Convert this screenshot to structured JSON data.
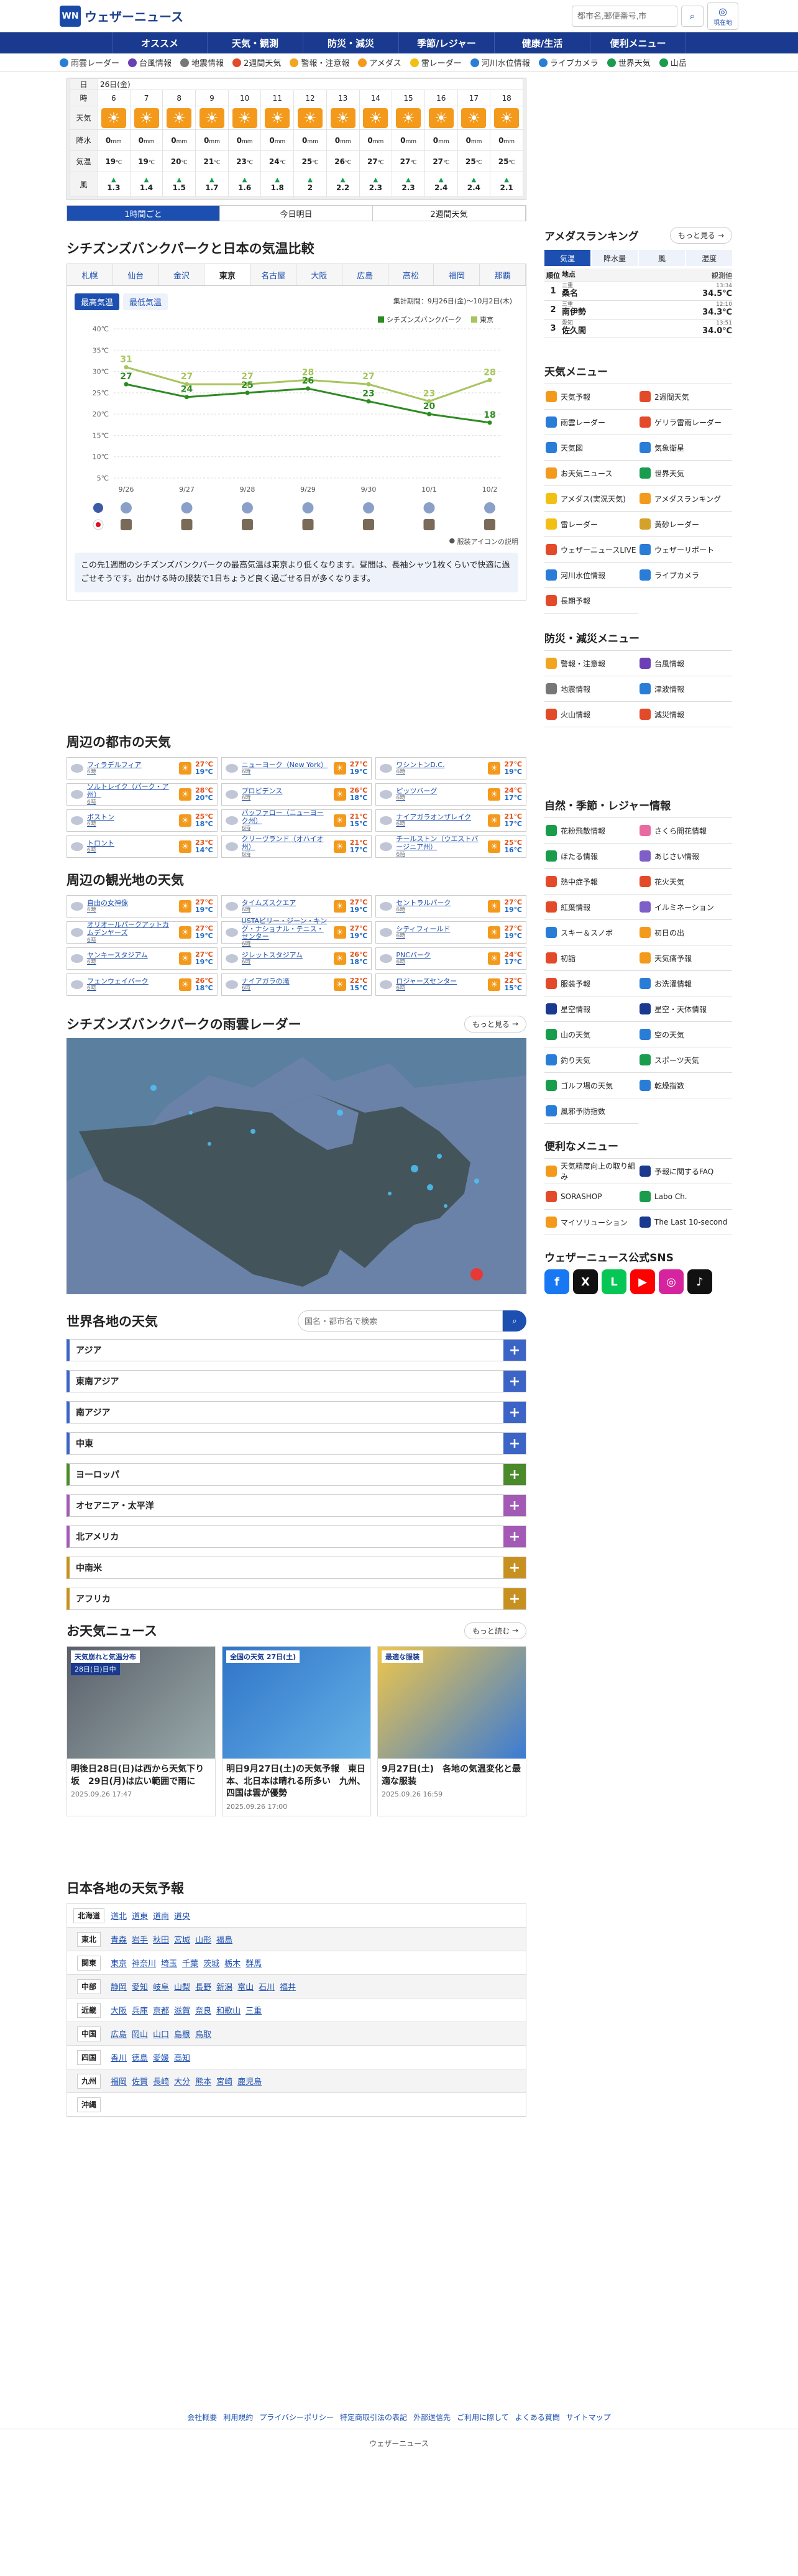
{
  "brand": {
    "logo_mark": "WN",
    "name": "ウェザーニュース"
  },
  "header": {
    "search_placeholder": "都市名,郵便番号,市",
    "current_label": "現在地"
  },
  "nav": [
    "オススメ",
    "天気・観測",
    "防災・減災",
    "季節/レジャー",
    "健康/生活",
    "便利メニュー"
  ],
  "subnav": [
    {
      "label": "雨雲レーダー",
      "color": "#2a7dd6"
    },
    {
      "label": "台風情報",
      "color": "#6c3fb7"
    },
    {
      "label": "地震情報",
      "color": "#777"
    },
    {
      "label": "2週間天気",
      "color": "#e34a2a"
    },
    {
      "label": "警報・注意報",
      "color": "#f2a520"
    },
    {
      "label": "アメダス",
      "color": "#f39a1c"
    },
    {
      "label": "雷レーダー",
      "color": "#f2c014"
    },
    {
      "label": "河川水位情報",
      "color": "#2a7dd6"
    },
    {
      "label": "ライブカメラ",
      "color": "#2a7dd6"
    },
    {
      "label": "世界天気",
      "color": "#1a9c4d"
    },
    {
      "label": "山岳",
      "color": "#1a9c4d"
    }
  ],
  "forecast": {
    "date_label": "26日(金)",
    "row_hour": "時",
    "row_day": "日",
    "row_weather": "天気",
    "row_rain": "降水",
    "row_temp": "気温",
    "row_wind": "風",
    "hours": [
      "6",
      "7",
      "8",
      "9",
      "10",
      "11",
      "12",
      "13",
      "14",
      "15",
      "16",
      "17",
      "18"
    ],
    "rain": [
      "0",
      "0",
      "0",
      "0",
      "0",
      "0",
      "0",
      "0",
      "0",
      "0",
      "0",
      "0",
      "0"
    ],
    "temps": [
      "19",
      "19",
      "20",
      "21",
      "23",
      "24",
      "25",
      "26",
      "27",
      "27",
      "27",
      "25",
      "25"
    ],
    "wind": [
      "1.3",
      "1.4",
      "1.5",
      "1.7",
      "1.6",
      "1.8",
      "2",
      "2.2",
      "2.3",
      "2.3",
      "2.4",
      "2.4",
      "2.1"
    ],
    "tabs": [
      "1時間ごと",
      "今日明日",
      "2週間天気"
    ]
  },
  "compare": {
    "title": "シチズンズバンクパークと日本の気温比較",
    "regions": [
      "札幌",
      "仙台",
      "金沢",
      "東京",
      "名古屋",
      "大阪",
      "広島",
      "高松",
      "福岡",
      "那覇"
    ],
    "type_buttons": [
      "最高気温",
      "最低気温"
    ],
    "period": "集計期間：9月26日(金)〜10月2日(木)",
    "icon_note": "服装アイコンの説明",
    "note": "この先1週間のシチズンズバンクパークの最高気温は東京より低くなります。昼間は、長袖シャツ1枚くらいで快適に過ごせそうです。出かける時の服装で1日ちょうど良く過ごせる日が多くなります。"
  },
  "chart_data": {
    "type": "line",
    "title": "",
    "x": [
      "9/26",
      "9/27",
      "9/28",
      "9/29",
      "9/30",
      "10/1",
      "10/2"
    ],
    "ylim": [
      5,
      40
    ],
    "yticks": [
      "5℃",
      "10℃",
      "15℃",
      "20℃",
      "25℃",
      "30℃",
      "35℃",
      "40℃"
    ],
    "grid": true,
    "legend": "top-right",
    "series": [
      {
        "name": "シチズンズバンクパーク",
        "color": "#2e8b23",
        "values": [
          27,
          24,
          25,
          26,
          23,
          20,
          18
        ]
      },
      {
        "name": "東京",
        "color": "#a6c55b",
        "values": [
          31,
          27,
          27,
          28,
          27,
          23,
          28
        ]
      }
    ]
  },
  "cities": {
    "title": "周辺の都市の天気",
    "day": "6時",
    "items": [
      {
        "name": "フィラデルフィア",
        "hi": "27℃",
        "lo": "19℃"
      },
      {
        "name": "ニューヨーク（New York）",
        "hi": "27℃",
        "lo": "19℃"
      },
      {
        "name": "ワシントンD.C.",
        "hi": "27℃",
        "lo": "19℃"
      },
      {
        "name": "ソルトレイク（パーク・ア州）",
        "hi": "28℃",
        "lo": "20℃"
      },
      {
        "name": "プロビデンス",
        "hi": "26℃",
        "lo": "18℃"
      },
      {
        "name": "ピッツバーグ",
        "hi": "24℃",
        "lo": "17℃"
      },
      {
        "name": "ボストン",
        "hi": "25℃",
        "lo": "18℃"
      },
      {
        "name": "バッファロー（ニューヨーク州）",
        "hi": "21℃",
        "lo": "15℃"
      },
      {
        "name": "ナイアガラオンザレイク",
        "hi": "21℃",
        "lo": "17℃"
      },
      {
        "name": "トロント",
        "hi": "23℃",
        "lo": "14℃"
      },
      {
        "name": "クリーヴランド（オハイオ州）",
        "hi": "21℃",
        "lo": "17℃"
      },
      {
        "name": "チールストン（ウエストバージニア州）",
        "hi": "25℃",
        "lo": "16℃"
      }
    ]
  },
  "sights": {
    "title": "周辺の観光地の天気",
    "items": [
      {
        "name": "自由の女神像",
        "hi": "27℃",
        "lo": "19℃"
      },
      {
        "name": "タイムズスクエア",
        "hi": "27℃",
        "lo": "19℃"
      },
      {
        "name": "セントラルパーク",
        "hi": "27℃",
        "lo": "19℃"
      },
      {
        "name": "オリオールパークアットカムデンヤーズ",
        "hi": "27℃",
        "lo": "19℃"
      },
      {
        "name": "USTAビリー・ジーン・キング・ナショナル・テニス・センター",
        "hi": "27℃",
        "lo": "19℃"
      },
      {
        "name": "シティフィールド",
        "hi": "27℃",
        "lo": "19℃"
      },
      {
        "name": "ヤンキースタジアム",
        "hi": "27℃",
        "lo": "19℃"
      },
      {
        "name": "ジレットスタジアム",
        "hi": "26℃",
        "lo": "18℃"
      },
      {
        "name": "PNCパーク",
        "hi": "24℃",
        "lo": "17℃"
      },
      {
        "name": "フェンウェイパーク",
        "hi": "26℃",
        "lo": "18℃"
      },
      {
        "name": "ナイアガラの滝",
        "hi": "22℃",
        "lo": "15℃"
      },
      {
        "name": "ロジャーズセンター",
        "hi": "22℃",
        "lo": "15℃"
      }
    ]
  },
  "radar": {
    "title": "シチズンズバンクパークの雨雲レーダー",
    "more": "もっと見る"
  },
  "world": {
    "title": "世界各地の天気",
    "search_placeholder": "国名・都市名で検索",
    "regions": [
      {
        "label": "アジア",
        "color": "#3b64c6"
      },
      {
        "label": "東南アジア",
        "color": "#3b64c6"
      },
      {
        "label": "南アジア",
        "color": "#3b64c6"
      },
      {
        "label": "中東",
        "color": "#3b64c6"
      },
      {
        "label": "ヨーロッパ",
        "color": "#4b8a2a"
      },
      {
        "label": "オセアニア・太平洋",
        "color": "#a25ab5"
      },
      {
        "label": "北アメリカ",
        "color": "#a25ab5"
      },
      {
        "label": "中南米",
        "color": "#c79122"
      },
      {
        "label": "アフリカ",
        "color": "#c79122"
      }
    ]
  },
  "news": {
    "title": "お天気ニュース",
    "more": "もっと読む",
    "items": [
      {
        "title": "明後日28日(日)は西から天気下り坂　29日(月)は広い範囲で雨に",
        "date": "2025.09.26 17:47",
        "tag": "天気崩れと気温分布",
        "tag2": "28日(日)日中"
      },
      {
        "title": "明日9月27日(土)の天気予報　東日本、北日本は晴れる所多い　九州、四国は雲が優勢",
        "date": "2025.09.26 17:00",
        "tag": "全国の天気 27日(土)",
        "tag2": ""
      },
      {
        "title": "9月27日(土)　各地の気温変化と最適な服装",
        "date": "2025.09.26 16:59",
        "tag": "最適な服装",
        "tag2": ""
      }
    ]
  },
  "japan": {
    "title": "日本各地の天気予報",
    "rows": [
      {
        "region": "北海道",
        "prefs": [
          "道北",
          "道東",
          "道南",
          "道央"
        ]
      },
      {
        "region": "東北",
        "prefs": [
          "青森",
          "岩手",
          "秋田",
          "宮城",
          "山形",
          "福島"
        ]
      },
      {
        "region": "関東",
        "prefs": [
          "東京",
          "神奈川",
          "埼玉",
          "千葉",
          "茨城",
          "栃木",
          "群馬"
        ]
      },
      {
        "region": "中部",
        "prefs": [
          "静岡",
          "愛知",
          "岐阜",
          "山梨",
          "長野",
          "新潟",
          "富山",
          "石川",
          "福井"
        ]
      },
      {
        "region": "近畿",
        "prefs": [
          "大阪",
          "兵庫",
          "京都",
          "滋賀",
          "奈良",
          "和歌山",
          "三重"
        ]
      },
      {
        "region": "中国",
        "prefs": [
          "広島",
          "岡山",
          "山口",
          "島根",
          "鳥取"
        ]
      },
      {
        "region": "四国",
        "prefs": [
          "香川",
          "徳島",
          "愛媛",
          "高知"
        ]
      },
      {
        "region": "九州",
        "prefs": [
          "福岡",
          "佐賀",
          "長崎",
          "大分",
          "熊本",
          "宮崎",
          "鹿児島"
        ]
      },
      {
        "region": "沖縄",
        "prefs": []
      }
    ]
  },
  "amedas": {
    "title": "アメダスランキング",
    "more": "もっと見る",
    "tabs": [
      "気温",
      "降水量",
      "風",
      "湿度"
    ],
    "h_rank": "順位",
    "h_place": "地点",
    "h_time": "観測値",
    "rows": [
      {
        "rank": "1",
        "pref": "三重",
        "place": "桑名",
        "time": "13:34",
        "value": "34.5℃"
      },
      {
        "rank": "2",
        "pref": "三重",
        "place": "南伊勢",
        "time": "12:10",
        "value": "34.3℃"
      },
      {
        "rank": "3",
        "pref": "愛知",
        "place": "佐久間",
        "time": "13:51",
        "value": "34.0℃"
      }
    ]
  },
  "menu_weather": {
    "title": "天気メニュー",
    "items": [
      {
        "label": "天気予報",
        "color": "#f39a1c"
      },
      {
        "label": "2週間天気",
        "color": "#e34a2a"
      },
      {
        "label": "雨雲レーダー",
        "color": "#2a7dd6"
      },
      {
        "label": "ゲリラ雷雨レーダー",
        "color": "#e34a2a"
      },
      {
        "label": "天気図",
        "color": "#2a7dd6"
      },
      {
        "label": "気象衛星",
        "color": "#2a7dd6"
      },
      {
        "label": "お天気ニュース",
        "color": "#f39a1c"
      },
      {
        "label": "世界天気",
        "color": "#1a9c4d"
      },
      {
        "label": "アメダス(実況天気)",
        "color": "#f2c014"
      },
      {
        "label": "アメダスランキング",
        "color": "#f39a1c"
      },
      {
        "label": "雷レーダー",
        "color": "#f2c014"
      },
      {
        "label": "黄砂レーダー",
        "color": "#d4a12a"
      },
      {
        "label": "ウェザーニュースLIVE",
        "color": "#e34a2a"
      },
      {
        "label": "ウェザーリポート",
        "color": "#2a7dd6"
      },
      {
        "label": "河川水位情報",
        "color": "#2a7dd6"
      },
      {
        "label": "ライブカメラ",
        "color": "#2a7dd6"
      },
      {
        "label": "長期予報",
        "color": "#e34a2a"
      }
    ]
  },
  "menu_disaster": {
    "title": "防災・減災メニュー",
    "items": [
      {
        "label": "警報・注意報",
        "color": "#f2a520"
      },
      {
        "label": "台風情報",
        "color": "#6c3fb7"
      },
      {
        "label": "地震情報",
        "color": "#777"
      },
      {
        "label": "津波情報",
        "color": "#2a7dd6"
      },
      {
        "label": "火山情報",
        "color": "#e34a2a"
      },
      {
        "label": "減災情報",
        "color": "#e34a2a"
      }
    ]
  },
  "menu_nature": {
    "title": "自然・季節・レジャー情報",
    "items": [
      {
        "label": "花粉飛散情報",
        "color": "#1a9c4d"
      },
      {
        "label": "さくら開花情報",
        "color": "#e86aa0"
      },
      {
        "label": "ほたる情報",
        "color": "#1a9c4d"
      },
      {
        "label": "あじさい情報",
        "color": "#7e5ec7"
      },
      {
        "label": "熱中症予報",
        "color": "#e34a2a"
      },
      {
        "label": "花火天気",
        "color": "#e34a2a"
      },
      {
        "label": "紅葉情報",
        "color": "#e34a2a"
      },
      {
        "label": "イルミネーション",
        "color": "#7e5ec7"
      },
      {
        "label": "スキー＆スノボ",
        "color": "#2a7dd6"
      },
      {
        "label": "初日の出",
        "color": "#f39a1c"
      },
      {
        "label": "初詣",
        "color": "#e34a2a"
      },
      {
        "label": "天気痛予報",
        "color": "#f39a1c"
      },
      {
        "label": "服装予報",
        "color": "#e34a2a"
      },
      {
        "label": "お洗濯情報",
        "color": "#2a7dd6"
      },
      {
        "label": "星空情報",
        "color": "#1a3a8f"
      },
      {
        "label": "星空・天体情報",
        "color": "#1a3a8f"
      },
      {
        "label": "山の天気",
        "color": "#1a9c4d"
      },
      {
        "label": "空の天気",
        "color": "#2a7dd6"
      },
      {
        "label": "釣り天気",
        "color": "#2a7dd6"
      },
      {
        "label": "スポーツ天気",
        "color": "#1a9c4d"
      },
      {
        "label": "ゴルフ場の天気",
        "color": "#1a9c4d"
      },
      {
        "label": "乾燥指数",
        "color": "#2a7dd6"
      },
      {
        "label": "風邪予防指数",
        "color": "#2a7dd6"
      }
    ]
  },
  "menu_useful": {
    "title": "便利なメニュー",
    "items": [
      {
        "label": "天気精度向上の取り組み",
        "color": "#f39a1c"
      },
      {
        "label": "予報に関するFAQ",
        "color": "#1a3a8f"
      },
      {
        "label": "SORASHOP",
        "color": "#e34a2a"
      },
      {
        "label": "Labo Ch.",
        "color": "#1a9c4d"
      },
      {
        "label": "マイソリューション",
        "color": "#f39a1c"
      },
      {
        "label": "The Last 10-second",
        "color": "#1a3a8f"
      }
    ]
  },
  "sns": {
    "title": "ウェザーニュース公式SNS",
    "items": [
      {
        "label": "f",
        "color": "#1877f2"
      },
      {
        "label": "X",
        "color": "#111"
      },
      {
        "label": "L",
        "color": "#06c755"
      },
      {
        "label": "▶",
        "color": "#ff0000"
      },
      {
        "label": "◎",
        "color": "#d6249f"
      },
      {
        "label": "♪",
        "color": "#111"
      }
    ]
  },
  "footer": {
    "links": [
      "会社概要",
      "利用規約",
      "プライバシーポリシー",
      "特定商取引法の表記",
      "外部送信先",
      "ご利用に際して",
      "よくある質問",
      "サイトマップ"
    ],
    "copyright": "ウェザーニュース"
  }
}
